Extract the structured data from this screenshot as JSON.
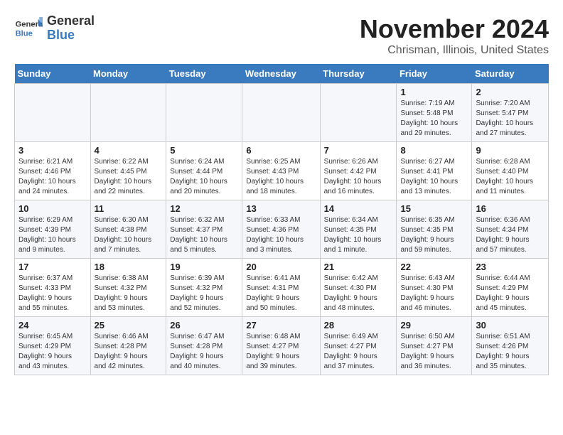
{
  "header": {
    "logo_line1": "General",
    "logo_line2": "Blue",
    "month_title": "November 2024",
    "location": "Chrisman, Illinois, United States"
  },
  "days_of_week": [
    "Sunday",
    "Monday",
    "Tuesday",
    "Wednesday",
    "Thursday",
    "Friday",
    "Saturday"
  ],
  "weeks": [
    [
      {
        "day": "",
        "info": ""
      },
      {
        "day": "",
        "info": ""
      },
      {
        "day": "",
        "info": ""
      },
      {
        "day": "",
        "info": ""
      },
      {
        "day": "",
        "info": ""
      },
      {
        "day": "1",
        "info": "Sunrise: 7:19 AM\nSunset: 5:48 PM\nDaylight: 10 hours\nand 29 minutes."
      },
      {
        "day": "2",
        "info": "Sunrise: 7:20 AM\nSunset: 5:47 PM\nDaylight: 10 hours\nand 27 minutes."
      }
    ],
    [
      {
        "day": "3",
        "info": "Sunrise: 6:21 AM\nSunset: 4:46 PM\nDaylight: 10 hours\nand 24 minutes."
      },
      {
        "day": "4",
        "info": "Sunrise: 6:22 AM\nSunset: 4:45 PM\nDaylight: 10 hours\nand 22 minutes."
      },
      {
        "day": "5",
        "info": "Sunrise: 6:24 AM\nSunset: 4:44 PM\nDaylight: 10 hours\nand 20 minutes."
      },
      {
        "day": "6",
        "info": "Sunrise: 6:25 AM\nSunset: 4:43 PM\nDaylight: 10 hours\nand 18 minutes."
      },
      {
        "day": "7",
        "info": "Sunrise: 6:26 AM\nSunset: 4:42 PM\nDaylight: 10 hours\nand 16 minutes."
      },
      {
        "day": "8",
        "info": "Sunrise: 6:27 AM\nSunset: 4:41 PM\nDaylight: 10 hours\nand 13 minutes."
      },
      {
        "day": "9",
        "info": "Sunrise: 6:28 AM\nSunset: 4:40 PM\nDaylight: 10 hours\nand 11 minutes."
      }
    ],
    [
      {
        "day": "10",
        "info": "Sunrise: 6:29 AM\nSunset: 4:39 PM\nDaylight: 10 hours\nand 9 minutes."
      },
      {
        "day": "11",
        "info": "Sunrise: 6:30 AM\nSunset: 4:38 PM\nDaylight: 10 hours\nand 7 minutes."
      },
      {
        "day": "12",
        "info": "Sunrise: 6:32 AM\nSunset: 4:37 PM\nDaylight: 10 hours\nand 5 minutes."
      },
      {
        "day": "13",
        "info": "Sunrise: 6:33 AM\nSunset: 4:36 PM\nDaylight: 10 hours\nand 3 minutes."
      },
      {
        "day": "14",
        "info": "Sunrise: 6:34 AM\nSunset: 4:35 PM\nDaylight: 10 hours\nand 1 minute."
      },
      {
        "day": "15",
        "info": "Sunrise: 6:35 AM\nSunset: 4:35 PM\nDaylight: 9 hours\nand 59 minutes."
      },
      {
        "day": "16",
        "info": "Sunrise: 6:36 AM\nSunset: 4:34 PM\nDaylight: 9 hours\nand 57 minutes."
      }
    ],
    [
      {
        "day": "17",
        "info": "Sunrise: 6:37 AM\nSunset: 4:33 PM\nDaylight: 9 hours\nand 55 minutes."
      },
      {
        "day": "18",
        "info": "Sunrise: 6:38 AM\nSunset: 4:32 PM\nDaylight: 9 hours\nand 53 minutes."
      },
      {
        "day": "19",
        "info": "Sunrise: 6:39 AM\nSunset: 4:32 PM\nDaylight: 9 hours\nand 52 minutes."
      },
      {
        "day": "20",
        "info": "Sunrise: 6:41 AM\nSunset: 4:31 PM\nDaylight: 9 hours\nand 50 minutes."
      },
      {
        "day": "21",
        "info": "Sunrise: 6:42 AM\nSunset: 4:30 PM\nDaylight: 9 hours\nand 48 minutes."
      },
      {
        "day": "22",
        "info": "Sunrise: 6:43 AM\nSunset: 4:30 PM\nDaylight: 9 hours\nand 46 minutes."
      },
      {
        "day": "23",
        "info": "Sunrise: 6:44 AM\nSunset: 4:29 PM\nDaylight: 9 hours\nand 45 minutes."
      }
    ],
    [
      {
        "day": "24",
        "info": "Sunrise: 6:45 AM\nSunset: 4:29 PM\nDaylight: 9 hours\nand 43 minutes."
      },
      {
        "day": "25",
        "info": "Sunrise: 6:46 AM\nSunset: 4:28 PM\nDaylight: 9 hours\nand 42 minutes."
      },
      {
        "day": "26",
        "info": "Sunrise: 6:47 AM\nSunset: 4:28 PM\nDaylight: 9 hours\nand 40 minutes."
      },
      {
        "day": "27",
        "info": "Sunrise: 6:48 AM\nSunset: 4:27 PM\nDaylight: 9 hours\nand 39 minutes."
      },
      {
        "day": "28",
        "info": "Sunrise: 6:49 AM\nSunset: 4:27 PM\nDaylight: 9 hours\nand 37 minutes."
      },
      {
        "day": "29",
        "info": "Sunrise: 6:50 AM\nSunset: 4:27 PM\nDaylight: 9 hours\nand 36 minutes."
      },
      {
        "day": "30",
        "info": "Sunrise: 6:51 AM\nSunset: 4:26 PM\nDaylight: 9 hours\nand 35 minutes."
      }
    ]
  ]
}
